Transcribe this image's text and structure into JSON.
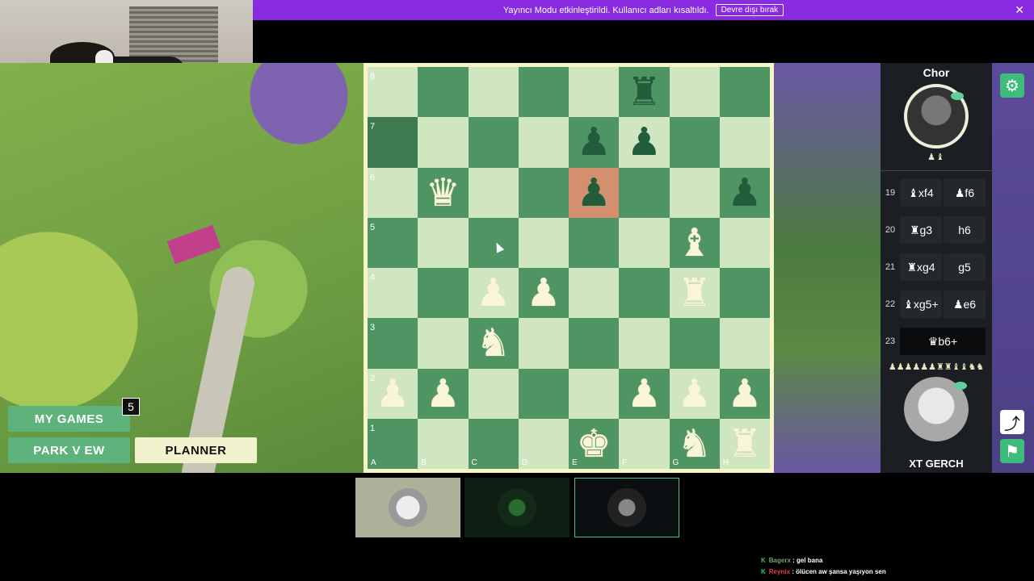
{
  "notice": {
    "text": "Yayıncı Modu etkinleştirildi. Kullanıcı adları kısaltıldı.",
    "button": "Devre dışı bırak",
    "close": "✕"
  },
  "left_buttons": {
    "my_games": "MY GAMES",
    "my_games_badge": "5",
    "park_view": "PARK V EW",
    "planner": "PLANNER"
  },
  "board": {
    "ranks": [
      "8",
      "7",
      "6",
      "5",
      "4",
      "3",
      "2",
      "1"
    ],
    "files": [
      "A",
      "B",
      "C",
      "D",
      "E",
      "F",
      "G",
      "H"
    ],
    "pieces": [
      {
        "sq": "f8",
        "glyph": "♜",
        "color": "b"
      },
      {
        "sq": "e7",
        "glyph": "♟",
        "color": "b"
      },
      {
        "sq": "f7",
        "glyph": "♟",
        "color": "b"
      },
      {
        "sq": "e6",
        "glyph": "♟",
        "color": "b"
      },
      {
        "sq": "h6",
        "glyph": "♟",
        "color": "b"
      },
      {
        "sq": "b6",
        "glyph": "♛",
        "color": "w"
      },
      {
        "sq": "g5",
        "glyph": "♝",
        "color": "w"
      },
      {
        "sq": "c4",
        "glyph": "♟",
        "color": "w"
      },
      {
        "sq": "d4",
        "glyph": "♟",
        "color": "w"
      },
      {
        "sq": "g4",
        "glyph": "♜",
        "color": "w"
      },
      {
        "sq": "c3",
        "glyph": "♞",
        "color": "w"
      },
      {
        "sq": "a2",
        "glyph": "♟",
        "color": "w"
      },
      {
        "sq": "b2",
        "glyph": "♟",
        "color": "w"
      },
      {
        "sq": "f2",
        "glyph": "♟",
        "color": "w"
      },
      {
        "sq": "g2",
        "glyph": "♟",
        "color": "w"
      },
      {
        "sq": "h2",
        "glyph": "♟",
        "color": "w"
      },
      {
        "sq": "e1",
        "glyph": "♚",
        "color": "w"
      },
      {
        "sq": "g1",
        "glyph": "♞",
        "color": "w"
      },
      {
        "sq": "h1",
        "glyph": "♜",
        "color": "w"
      }
    ],
    "last_move_square": "e6",
    "prev_move_square": "a7",
    "colors": {
      "light": "#cfe6c0",
      "dark": "#4f9463",
      "highlight": "#d48f6e"
    }
  },
  "players": {
    "top": {
      "name": "Chor",
      "captured": "♟♝"
    },
    "bottom": {
      "name": "XT GERCH",
      "captured": "♟♟♟♟♟♟♜♜♝♝♞♞"
    }
  },
  "moves": [
    {
      "no": "19",
      "white": "♝xf4",
      "black": "♟f6"
    },
    {
      "no": "20",
      "white": "♜g3",
      "black": "h6"
    },
    {
      "no": "21",
      "white": "♜xg4",
      "black": "g5"
    },
    {
      "no": "22",
      "white": "♝xg5+",
      "black": "♟e6"
    },
    {
      "no": "23",
      "white": "♛b6+",
      "black": ""
    }
  ],
  "icons": {
    "settings": "⚙",
    "share": "⤴",
    "flag": "⚑"
  },
  "chat": [
    {
      "user": "Bagerx",
      "msg": ": gel bana"
    },
    {
      "user": "Reynix",
      "msg": ": ölücen aw şansa yaşıyon sen"
    }
  ]
}
